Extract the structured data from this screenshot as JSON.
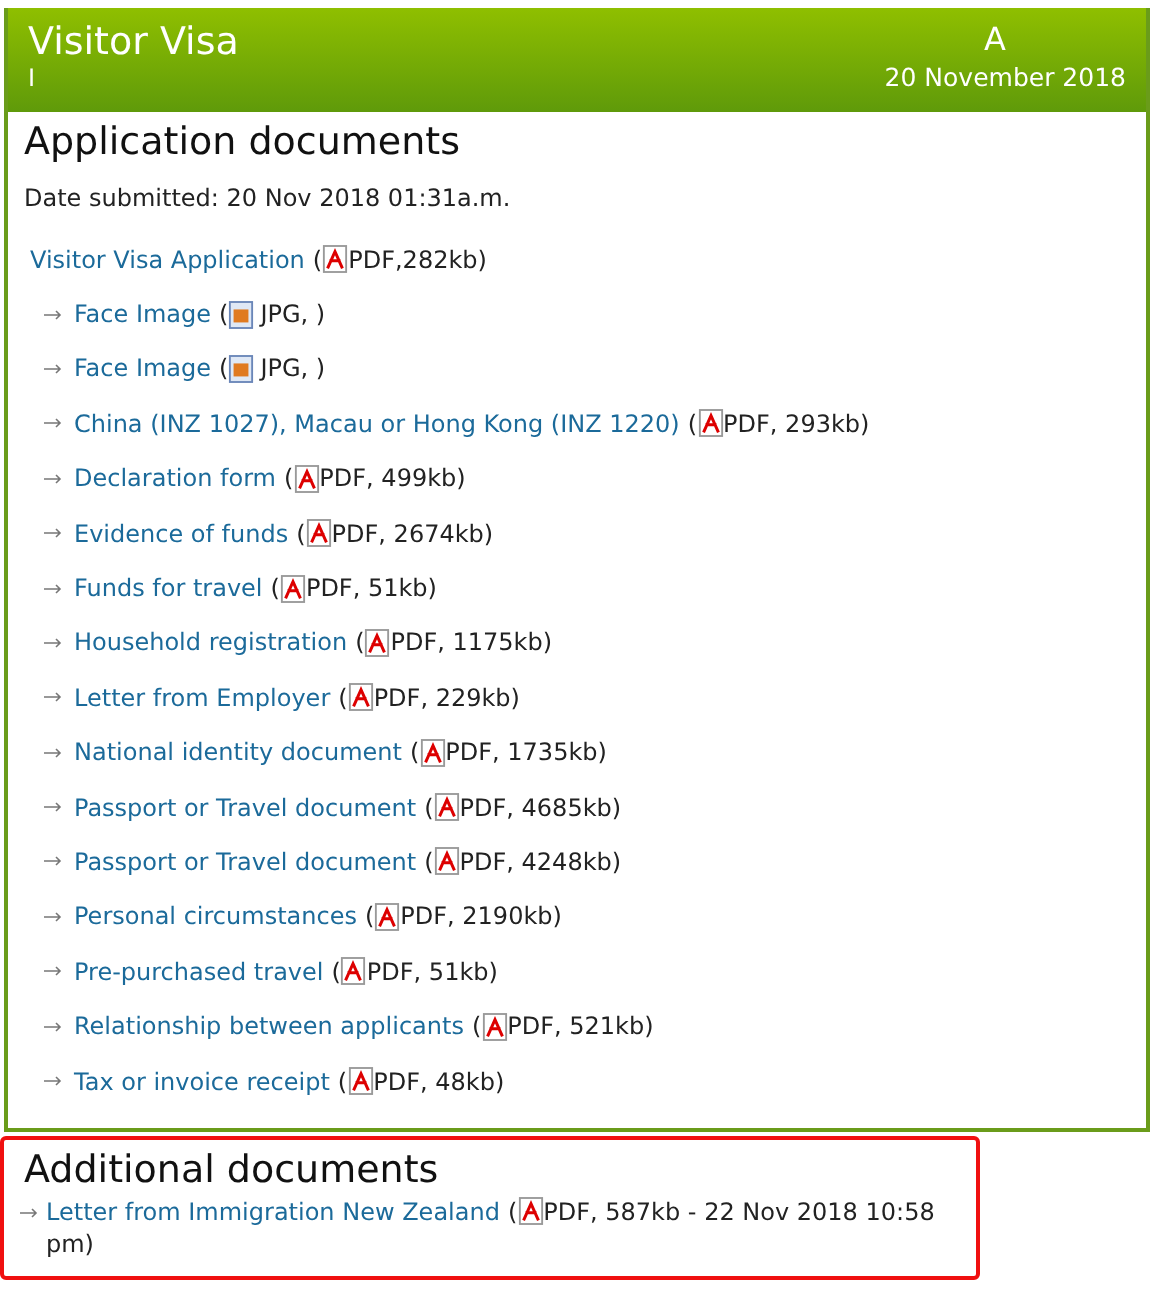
{
  "header": {
    "title": "Visitor Visa",
    "subtitle": "I",
    "name": "A",
    "date": "20 November 2018"
  },
  "application": {
    "heading": "Application documents",
    "date_submitted": "Date submitted: 20 Nov 2018  01:31a.m.",
    "main": {
      "label": "Visitor Visa Application",
      "kind": "pdf",
      "open": "(",
      "info": "PDF,282kb)"
    },
    "items": [
      {
        "label": "Face Image",
        "kind": "jpg",
        "open": "(",
        "info": "JPG, )"
      },
      {
        "label": "Face Image",
        "kind": "jpg",
        "open": "(",
        "info": "JPG, )"
      },
      {
        "label": "China (INZ 1027), Macau or Hong Kong (INZ 1220)",
        "kind": "pdf",
        "open": "(",
        "info": "PDF, 293kb)"
      },
      {
        "label": "Declaration form",
        "kind": "pdf",
        "open": "(",
        "info": "PDF, 499kb)"
      },
      {
        "label": "Evidence of funds",
        "kind": "pdf",
        "open": "(",
        "info": "PDF, 2674kb)"
      },
      {
        "label": "Funds for travel",
        "kind": "pdf",
        "open": "(",
        "info": "PDF, 51kb)"
      },
      {
        "label": "Household registration",
        "kind": "pdf",
        "open": "(",
        "info": "PDF, 1175kb)"
      },
      {
        "label": "Letter from Employer",
        "kind": "pdf",
        "open": "(",
        "info": "PDF, 229kb)"
      },
      {
        "label": "National identity document",
        "kind": "pdf",
        "open": "(",
        "info": "PDF, 1735kb)"
      },
      {
        "label": "Passport or Travel document",
        "kind": "pdf",
        "open": "(",
        "info": "PDF, 4685kb)"
      },
      {
        "label": "Passport or Travel document",
        "kind": "pdf",
        "open": "(",
        "info": "PDF, 4248kb)"
      },
      {
        "label": "Personal circumstances",
        "kind": "pdf",
        "open": "(",
        "info": "PDF, 2190kb)"
      },
      {
        "label": "Pre-purchased travel",
        "kind": "pdf",
        "open": "(",
        "info": "PDF, 51kb)"
      },
      {
        "label": "Relationship between applicants",
        "kind": "pdf",
        "open": "(",
        "info": "PDF, 521kb)"
      },
      {
        "label": "Tax or invoice receipt",
        "kind": "pdf",
        "open": "(",
        "info": "PDF, 48kb)"
      }
    ]
  },
  "additional": {
    "heading": "Additional documents",
    "items": [
      {
        "label": "Letter from Immigration New Zealand",
        "kind": "pdf",
        "open": "(",
        "info": "PDF, 587kb - 22 Nov 2018 10:58 pm)"
      }
    ]
  }
}
